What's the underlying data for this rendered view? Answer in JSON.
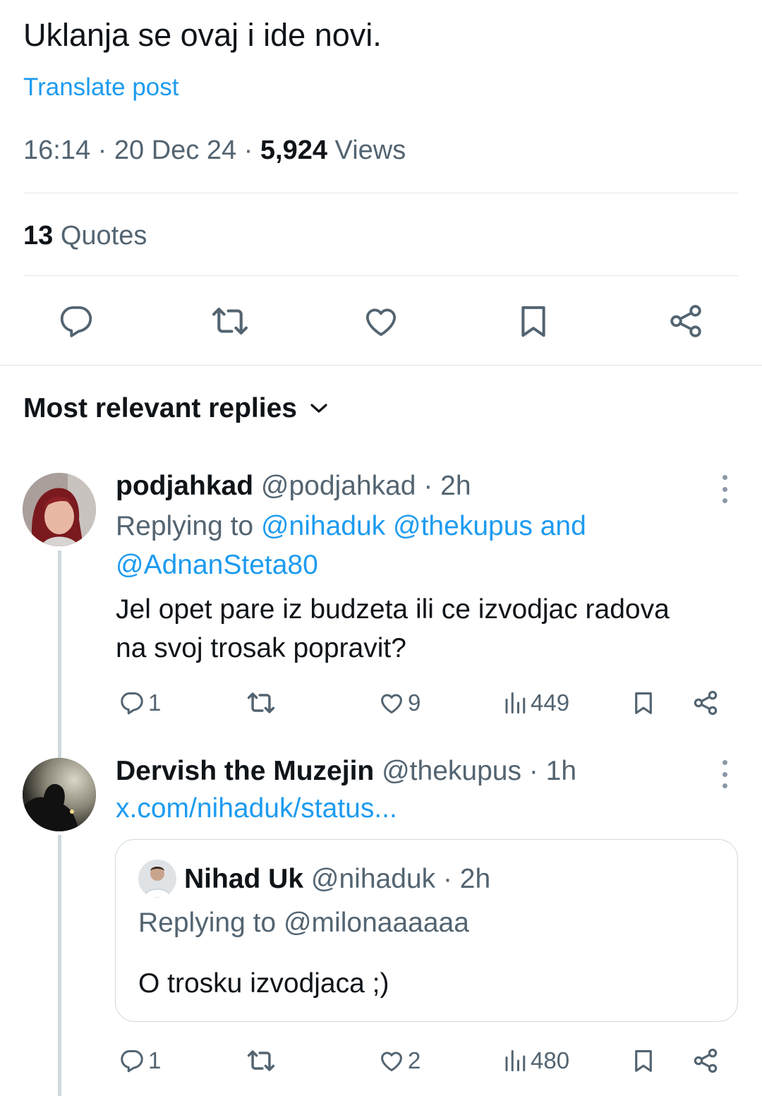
{
  "tweet": {
    "text": "Uklanja se ovaj i ide novi.",
    "translate_label": "Translate post",
    "time": "16:14",
    "date": "20 Dec 24",
    "views_count": "5,924",
    "views_label": "Views",
    "quotes_count": "13",
    "quotes_label": "Quotes"
  },
  "actions": [
    {
      "icon": "reply-icon"
    },
    {
      "icon": "retweet-icon"
    },
    {
      "icon": "like-icon"
    },
    {
      "icon": "bookmark-icon"
    },
    {
      "icon": "share-icon"
    }
  ],
  "replies_sort_label": "Most relevant replies",
  "replies": [
    {
      "name": "podjahkad",
      "handle": "@podjahkad",
      "time": "2h",
      "replying_prefix": "Replying to",
      "mentions_line1": "@nihaduk @thekupus and",
      "mentions_line2": "@AdnanSteta80",
      "text_line1": "Jel opet pare iz budzeta ili ce izvodjac radova",
      "text_line2": "na svoj trosak popravit?",
      "reply_count": "1",
      "like_count": "9",
      "views": "449"
    },
    {
      "name": "Dervish the Muzejin",
      "handle": "@thekupus",
      "time": "1h",
      "link": "x.com/nihaduk/status...",
      "quoted": {
        "name": "Nihad Uk",
        "handle": "@nihaduk",
        "time": "2h",
        "replying_prefix": "Replying to",
        "mention": "@milonaaaaaa",
        "text": "O trosku izvodjaca ;)"
      },
      "reply_count": "1",
      "like_count": "2",
      "views": "480"
    }
  ],
  "colors": {
    "accent": "#1d9bf0",
    "text": "#0f1419",
    "secondary": "#536471",
    "divider": "#e1e6ea"
  }
}
